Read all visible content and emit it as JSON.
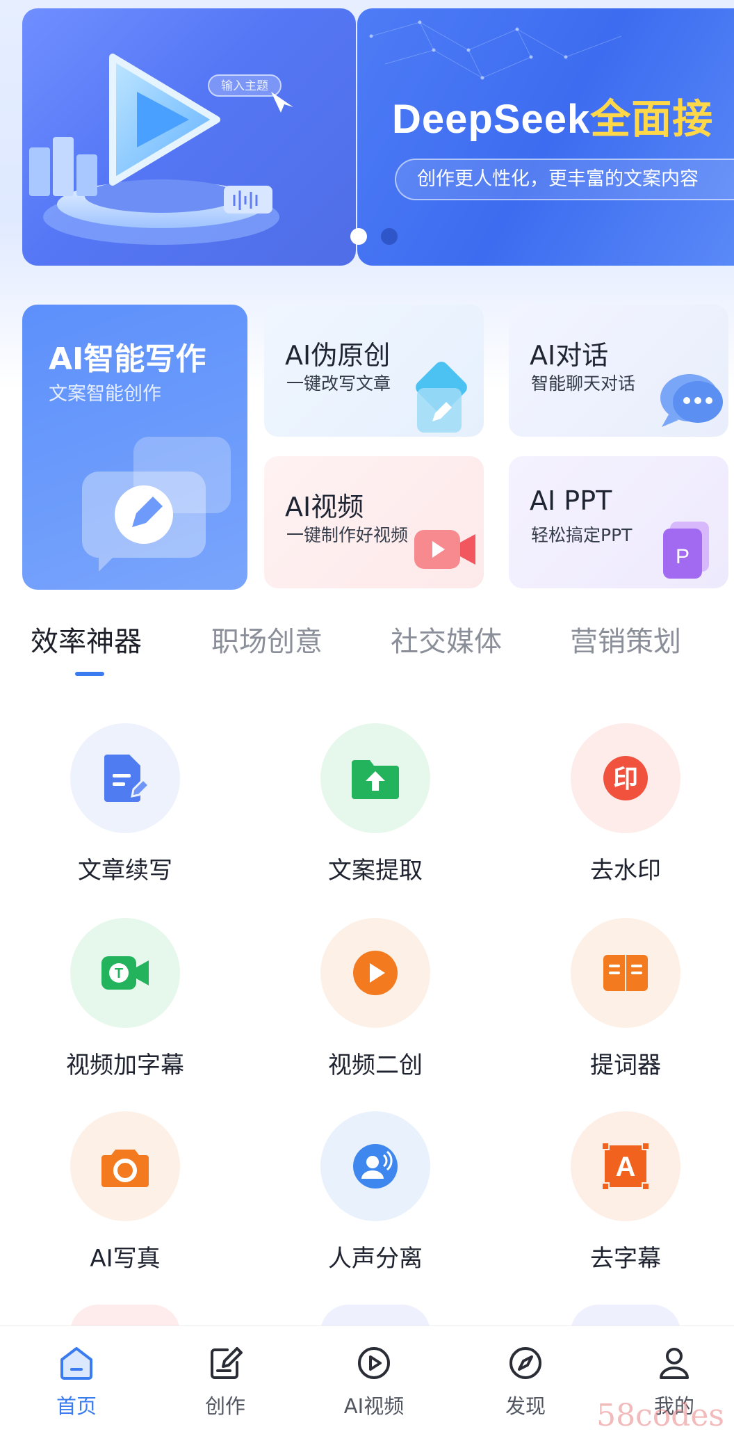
{
  "banner": {
    "input_chip": "输入主题",
    "title_main": "DeepSeek",
    "title_accent": "全面接",
    "subtitle": "创作更人性化，更丰富的文案内容",
    "page_count": 2,
    "active_index": 0
  },
  "features": {
    "big": {
      "title": "AI智能写作",
      "subtitle": "文案智能创作"
    },
    "cards": [
      {
        "title": "AI伪原创",
        "subtitle": "一键改写文章",
        "icon": "pen-edit-icon"
      },
      {
        "title": "AI对话",
        "subtitle": "智能聊天对话",
        "icon": "chat-bubble-icon"
      },
      {
        "title": "AI视频",
        "subtitle": "一键制作好视频",
        "icon": "video-camera-icon"
      },
      {
        "title": "AI PPT",
        "subtitle": "轻松搞定PPT",
        "icon": "ppt-file-icon"
      }
    ]
  },
  "tabs": [
    "效率神器",
    "职场创意",
    "社交媒体",
    "营销策划"
  ],
  "active_tab": 0,
  "tools": [
    {
      "label": "文章续写",
      "icon": "document-edit-icon",
      "color": "#4f7cf0",
      "bg": "#eef2fd"
    },
    {
      "label": "文案提取",
      "icon": "folder-upload-icon",
      "color": "#22b35c",
      "bg": "#e6f8ec"
    },
    {
      "label": "去水印",
      "icon": "stamp-icon",
      "color": "#f0523e",
      "bg": "#fdecea"
    },
    {
      "label": "视频加字幕",
      "icon": "video-text-icon",
      "color": "#22b35c",
      "bg": "#e6f8ec"
    },
    {
      "label": "视频二创",
      "icon": "play-circle-icon",
      "color": "#f47a20",
      "bg": "#fdf0e6"
    },
    {
      "label": "提词器",
      "icon": "book-open-icon",
      "color": "#f47a20",
      "bg": "#fdf0e6"
    },
    {
      "label": "AI写真",
      "icon": "camera-icon",
      "color": "#f47a20",
      "bg": "#fdf0e6"
    },
    {
      "label": "人声分离",
      "icon": "voice-person-icon",
      "color": "#3d87ef",
      "bg": "#e9f1fd"
    },
    {
      "label": "去字幕",
      "icon": "text-remove-icon",
      "color": "#f0621e",
      "bg": "#fdeee6"
    }
  ],
  "nav": [
    {
      "label": "首页",
      "icon": "home-icon",
      "active": true
    },
    {
      "label": "创作",
      "icon": "compose-icon",
      "active": false
    },
    {
      "label": "AI视频",
      "icon": "play-circle-icon",
      "active": false
    },
    {
      "label": "发现",
      "icon": "compass-icon",
      "active": false
    },
    {
      "label": "我的",
      "icon": "user-icon",
      "active": false
    }
  ],
  "watermark": "58codes",
  "colors": {
    "accent": "#3a7bf0",
    "banner_blue": "#3d6cf0",
    "accent_yellow": "#ffd84a"
  }
}
